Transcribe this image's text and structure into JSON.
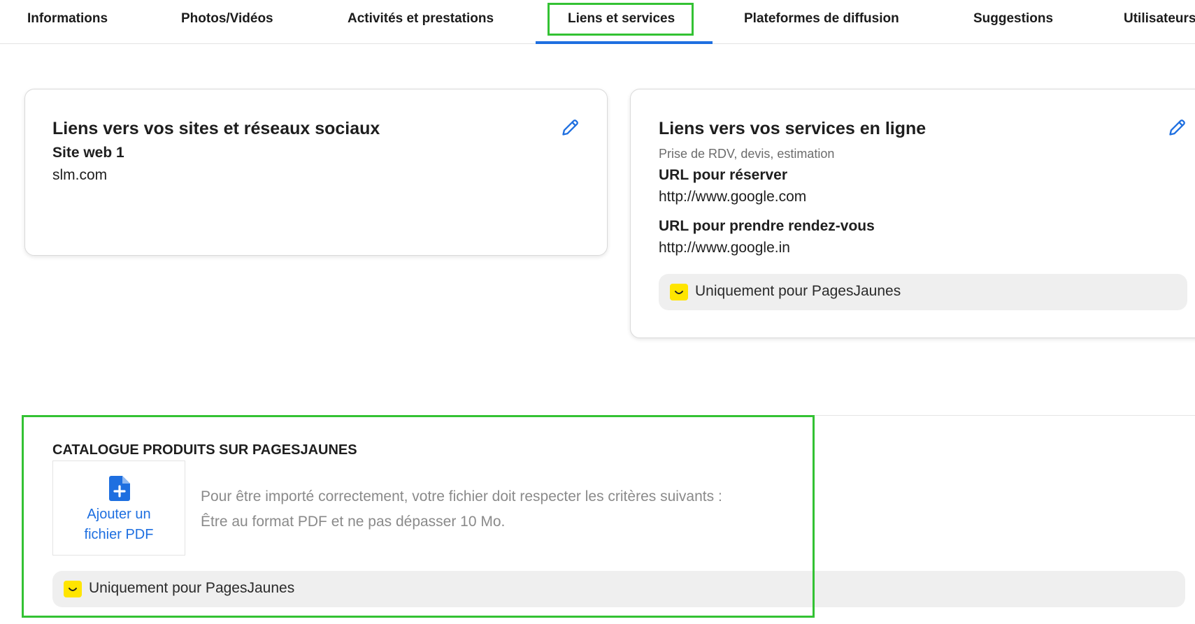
{
  "tabs": [
    {
      "label": "Informations"
    },
    {
      "label": "Photos/Vidéos"
    },
    {
      "label": "Activités et prestations"
    },
    {
      "label": "Liens et services",
      "active": true
    },
    {
      "label": "Plateformes de diffusion"
    },
    {
      "label": "Suggestions"
    },
    {
      "label": "Utilisateurs"
    }
  ],
  "social_card": {
    "title": "Liens vers vos sites et réseaux sociaux",
    "site_label": "Site web 1",
    "site_value": "slm.com",
    "edit_icon": "pencil-icon"
  },
  "services_card": {
    "title": "Liens vers vos services en ligne",
    "subtitle": "Prise de RDV, devis, estimation",
    "reserve_label": "URL pour réserver",
    "reserve_value": "http://www.google.com",
    "appointment_label": "URL pour prendre rendez-vous",
    "appointment_value": "http://www.google.in",
    "pj_note": "Uniquement pour PagesJaunes",
    "edit_icon": "pencil-icon"
  },
  "catalogue": {
    "title": "CATALOGUE PRODUITS SUR PAGESJAUNES",
    "upload_label_line1": "Ajouter un",
    "upload_label_line2": "fichier PDF",
    "upload_icon": "file-plus-icon",
    "criteria_line1": "Pour être importé correctement, votre fichier doit respecter les critères suivants :",
    "criteria_line2": "Être au format PDF et ne pas dépasser 10 Mo.",
    "pj_note": "Uniquement pour PagesJaunes"
  },
  "colors": {
    "accent": "#1e6fe0",
    "highlight": "#33c233",
    "pagesjaunes_yellow": "#ffe500"
  }
}
